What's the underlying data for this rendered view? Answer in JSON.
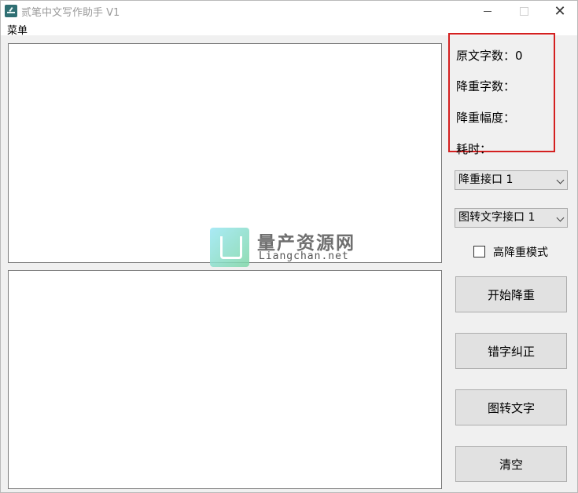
{
  "window": {
    "title": "贰笔中文写作助手 V1"
  },
  "menu": {
    "items": [
      {
        "label": "菜单"
      }
    ]
  },
  "stats": {
    "original_count": "原文字数：0",
    "reduced_count": "降重字数：",
    "reduction_ratio": "降重幅度：",
    "time_elapsed": "耗时："
  },
  "controls": {
    "reduce_api_selected": "降重接口 1",
    "ocr_api_selected": "图转文字接口 1",
    "high_mode_label": "高降重模式",
    "buttons": {
      "start": "开始降重",
      "correct": "错字纠正",
      "image_to_text": "图转文字",
      "clear": "清空"
    }
  },
  "watermark": {
    "title": "量产资源网",
    "site": "Liangchan.net"
  },
  "icons": {
    "app": "pen-icon",
    "minimize": "minimize-icon",
    "maximize": "maximize-icon",
    "close": "close-icon",
    "dropdown": "chevron-down-icon"
  },
  "colors": {
    "highlight_border": "#d42020",
    "window_bg": "#f0f0f0",
    "button_bg": "#e1e1e1"
  }
}
